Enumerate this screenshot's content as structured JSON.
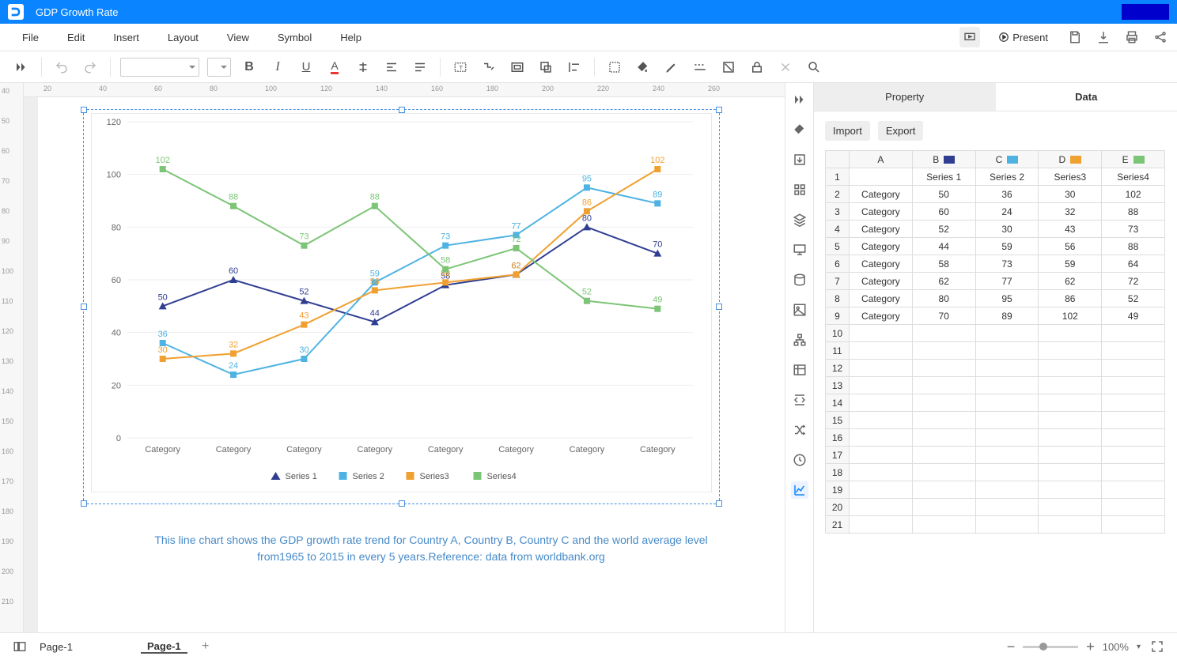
{
  "app": {
    "title": "GDP Growth Rate"
  },
  "menu": {
    "file": "File",
    "edit": "Edit",
    "insert": "Insert",
    "layout": "Layout",
    "view": "View",
    "symbol": "Symbol",
    "help": "Help",
    "present": "Present"
  },
  "panel": {
    "tabs": {
      "property": "Property",
      "data": "Data"
    },
    "buttons": {
      "import": "Import",
      "export": "Export"
    },
    "columns": [
      "A",
      "B",
      "C",
      "D",
      "E"
    ],
    "headers": [
      "",
      "Series 1",
      "Series 2",
      "Series3",
      "Series4"
    ],
    "num_blank_rows": 12,
    "colors": {
      "B": "#2f3e91",
      "C": "#4eb3e3",
      "D": "#f0a030",
      "E": "#7cc576"
    }
  },
  "chart_data": {
    "type": "line",
    "categories": [
      "Category",
      "Category",
      "Category",
      "Category",
      "Category",
      "Category",
      "Category",
      "Category"
    ],
    "series": [
      {
        "name": "Series 1",
        "color": "#2f3e91",
        "marker": "triangle",
        "values": [
          50,
          60,
          52,
          44,
          58,
          62,
          80,
          70
        ]
      },
      {
        "name": "Series 2",
        "color": "#4eb3e3",
        "marker": "square",
        "values": [
          36,
          24,
          30,
          59,
          73,
          77,
          95,
          89
        ]
      },
      {
        "name": "Series3",
        "color": "#f0a030",
        "marker": "square",
        "values": [
          30,
          32,
          43,
          56,
          59,
          62,
          86,
          102
        ]
      },
      {
        "name": "Series4",
        "color": "#7cc576",
        "marker": "square",
        "values": [
          102,
          88,
          73,
          88,
          64,
          72,
          52,
          49
        ]
      }
    ],
    "ylim": [
      0,
      120
    ],
    "ytick": 20,
    "label_overrides": {
      "3_4": "58"
    }
  },
  "caption": "This line chart shows the GDP growth rate trend for Country A, Country B, Country C and the world average level from1965 to 2015 in every 5 years.Reference: data from worldbank.org",
  "status": {
    "pageSelect": "Page-1",
    "pageTab": "Page-1",
    "zoom": "100%"
  },
  "ruler_h": [
    20,
    40,
    60,
    80,
    100,
    120,
    140,
    160,
    180,
    200,
    220,
    240,
    260
  ],
  "ruler_v": [
    40,
    50,
    60,
    70,
    80,
    90,
    100,
    110,
    120,
    130,
    140,
    150,
    160,
    170,
    180,
    190,
    200,
    210
  ]
}
